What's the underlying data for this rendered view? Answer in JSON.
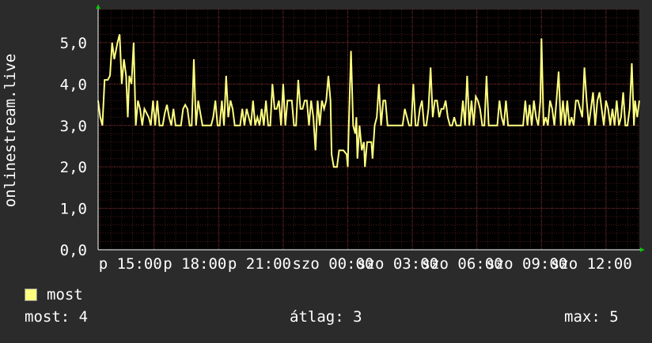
{
  "chart_data": {
    "type": "line",
    "ylabel": "onlinestream.live",
    "ylim": [
      0,
      5.8
    ],
    "yticks": [
      0,
      1,
      2,
      3,
      4,
      5
    ],
    "ytick_labels": [
      "0,0",
      "1,0",
      "2,0",
      "3,0",
      "4,0",
      "5,0"
    ],
    "xlim": [
      12.4,
      37.55
    ],
    "xticks": [
      15,
      18,
      21,
      24,
      27,
      30,
      33,
      36
    ],
    "xtick_labels": [
      "p 15:00",
      "p 18:00",
      "p 21:00",
      "szo 00:00",
      "szo 03:00",
      "szo 06:00",
      "szo 09:00",
      "szo 12:00"
    ],
    "grid": true,
    "series": [
      {
        "name": "most",
        "color": "#ffff80",
        "points": [
          [
            12.4,
            3.6
          ],
          [
            12.5,
            3.2
          ],
          [
            12.6,
            3.0
          ],
          [
            12.7,
            4.1
          ],
          [
            12.85,
            4.1
          ],
          [
            12.95,
            4.2
          ],
          [
            13.05,
            5.0
          ],
          [
            13.15,
            4.6
          ],
          [
            13.3,
            5.0
          ],
          [
            13.4,
            5.2
          ],
          [
            13.5,
            4.0
          ],
          [
            13.6,
            4.6
          ],
          [
            13.7,
            4.2
          ],
          [
            13.78,
            3.2
          ],
          [
            13.85,
            4.2
          ],
          [
            13.95,
            4.0
          ],
          [
            14.05,
            5.0
          ],
          [
            14.15,
            3.0
          ],
          [
            14.25,
            3.6
          ],
          [
            14.35,
            3.4
          ],
          [
            14.45,
            3.0
          ],
          [
            14.55,
            3.4
          ],
          [
            14.65,
            3.3
          ],
          [
            14.75,
            3.2
          ],
          [
            14.85,
            3.0
          ],
          [
            14.95,
            3.6
          ],
          [
            15.05,
            3.0
          ],
          [
            15.15,
            3.6
          ],
          [
            15.25,
            3.0
          ],
          [
            15.4,
            3.0
          ],
          [
            15.5,
            3.3
          ],
          [
            15.6,
            3.5
          ],
          [
            15.7,
            3.2
          ],
          [
            15.8,
            3.0
          ],
          [
            15.9,
            3.4
          ],
          [
            16.0,
            3.0
          ],
          [
            16.1,
            3.0
          ],
          [
            16.25,
            3.0
          ],
          [
            16.35,
            3.4
          ],
          [
            16.45,
            3.5
          ],
          [
            16.55,
            3.4
          ],
          [
            16.65,
            3.0
          ],
          [
            16.75,
            3.0
          ],
          [
            16.85,
            4.6
          ],
          [
            16.95,
            3.0
          ],
          [
            17.05,
            3.6
          ],
          [
            17.15,
            3.3
          ],
          [
            17.25,
            3.0
          ],
          [
            17.4,
            3.0
          ],
          [
            17.55,
            3.0
          ],
          [
            17.65,
            3.0
          ],
          [
            17.75,
            3.2
          ],
          [
            17.85,
            3.6
          ],
          [
            17.95,
            3.0
          ],
          [
            18.05,
            3.0
          ],
          [
            18.15,
            3.6
          ],
          [
            18.25,
            3.0
          ],
          [
            18.35,
            4.2
          ],
          [
            18.45,
            3.2
          ],
          [
            18.55,
            3.6
          ],
          [
            18.65,
            3.4
          ],
          [
            18.75,
            3.0
          ],
          [
            18.85,
            3.0
          ],
          [
            19.0,
            3.0
          ],
          [
            19.1,
            3.4
          ],
          [
            19.2,
            3.0
          ],
          [
            19.3,
            3.4
          ],
          [
            19.4,
            3.2
          ],
          [
            19.5,
            3.0
          ],
          [
            19.6,
            3.6
          ],
          [
            19.7,
            3.0
          ],
          [
            19.8,
            3.2
          ],
          [
            19.9,
            3.0
          ],
          [
            20.0,
            3.4
          ],
          [
            20.1,
            3.0
          ],
          [
            20.2,
            3.6
          ],
          [
            20.3,
            3.0
          ],
          [
            20.4,
            3.0
          ],
          [
            20.5,
            4.0
          ],
          [
            20.6,
            3.4
          ],
          [
            20.7,
            3.4
          ],
          [
            20.8,
            3.6
          ],
          [
            20.9,
            3.0
          ],
          [
            21.0,
            4.0
          ],
          [
            21.1,
            3.0
          ],
          [
            21.2,
            3.6
          ],
          [
            21.3,
            3.6
          ],
          [
            21.4,
            3.6
          ],
          [
            21.5,
            3.0
          ],
          [
            21.6,
            3.0
          ],
          [
            21.7,
            4.1
          ],
          [
            21.8,
            3.4
          ],
          [
            21.9,
            3.4
          ],
          [
            22.0,
            3.6
          ],
          [
            22.1,
            3.6
          ],
          [
            22.2,
            3.0
          ],
          [
            22.3,
            3.6
          ],
          [
            22.4,
            3.2
          ],
          [
            22.5,
            2.4
          ],
          [
            22.6,
            3.6
          ],
          [
            22.7,
            3.0
          ],
          [
            22.8,
            3.6
          ],
          [
            22.9,
            3.4
          ],
          [
            23.0,
            3.6
          ],
          [
            23.1,
            4.2
          ],
          [
            23.2,
            3.6
          ],
          [
            23.25,
            2.3
          ],
          [
            23.35,
            2.0
          ],
          [
            23.5,
            2.0
          ],
          [
            23.6,
            2.4
          ],
          [
            23.8,
            2.4
          ],
          [
            23.95,
            2.3
          ],
          [
            24.0,
            2.0
          ],
          [
            24.05,
            3.0
          ],
          [
            24.15,
            4.8
          ],
          [
            24.25,
            3.0
          ],
          [
            24.35,
            2.8
          ],
          [
            24.4,
            3.2
          ],
          [
            24.45,
            2.2
          ],
          [
            24.55,
            3.0
          ],
          [
            24.65,
            2.4
          ],
          [
            24.75,
            2.6
          ],
          [
            24.8,
            2.0
          ],
          [
            24.9,
            2.6
          ],
          [
            25.0,
            2.6
          ],
          [
            25.1,
            2.6
          ],
          [
            25.15,
            2.2
          ],
          [
            25.25,
            3.0
          ],
          [
            25.35,
            3.2
          ],
          [
            25.45,
            4.0
          ],
          [
            25.55,
            3.0
          ],
          [
            25.65,
            3.6
          ],
          [
            25.75,
            3.6
          ],
          [
            25.85,
            3.0
          ],
          [
            25.95,
            3.0
          ],
          [
            26.1,
            3.0
          ],
          [
            26.2,
            3.0
          ],
          [
            26.35,
            3.0
          ],
          [
            26.45,
            3.0
          ],
          [
            26.55,
            3.0
          ],
          [
            26.65,
            3.4
          ],
          [
            26.75,
            3.2
          ],
          [
            26.85,
            3.0
          ],
          [
            26.95,
            3.0
          ],
          [
            27.05,
            4.0
          ],
          [
            27.15,
            3.0
          ],
          [
            27.25,
            3.0
          ],
          [
            27.35,
            3.4
          ],
          [
            27.45,
            3.6
          ],
          [
            27.55,
            3.0
          ],
          [
            27.65,
            3.0
          ],
          [
            27.75,
            3.4
          ],
          [
            27.85,
            4.4
          ],
          [
            27.95,
            3.2
          ],
          [
            28.05,
            3.6
          ],
          [
            28.15,
            3.6
          ],
          [
            28.25,
            3.2
          ],
          [
            28.35,
            3.4
          ],
          [
            28.45,
            3.4
          ],
          [
            28.55,
            3.6
          ],
          [
            28.65,
            3.2
          ],
          [
            28.75,
            3.0
          ],
          [
            28.85,
            3.0
          ],
          [
            28.95,
            3.2
          ],
          [
            29.05,
            3.0
          ],
          [
            29.15,
            3.0
          ],
          [
            29.25,
            3.0
          ],
          [
            29.35,
            3.6
          ],
          [
            29.45,
            3.0
          ],
          [
            29.55,
            4.2
          ],
          [
            29.65,
            3.0
          ],
          [
            29.75,
            3.6
          ],
          [
            29.85,
            3.0
          ],
          [
            29.95,
            3.7
          ],
          [
            30.05,
            3.6
          ],
          [
            30.15,
            3.4
          ],
          [
            30.25,
            3.0
          ],
          [
            30.35,
            3.0
          ],
          [
            30.45,
            4.2
          ],
          [
            30.55,
            3.0
          ],
          [
            30.65,
            3.0
          ],
          [
            30.75,
            3.0
          ],
          [
            30.85,
            3.0
          ],
          [
            30.95,
            3.0
          ],
          [
            31.05,
            3.6
          ],
          [
            31.15,
            3.2
          ],
          [
            31.25,
            3.0
          ],
          [
            31.35,
            3.6
          ],
          [
            31.45,
            3.0
          ],
          [
            31.55,
            3.0
          ],
          [
            31.65,
            3.0
          ],
          [
            31.75,
            3.0
          ],
          [
            31.85,
            3.0
          ],
          [
            31.95,
            3.0
          ],
          [
            32.05,
            3.0
          ],
          [
            32.15,
            3.0
          ],
          [
            32.25,
            3.6
          ],
          [
            32.35,
            3.0
          ],
          [
            32.45,
            3.5
          ],
          [
            32.55,
            3.0
          ],
          [
            32.65,
            3.6
          ],
          [
            32.75,
            3.2
          ],
          [
            32.85,
            3.0
          ],
          [
            32.95,
            3.6
          ],
          [
            33.0,
            5.1
          ],
          [
            33.1,
            3.0
          ],
          [
            33.2,
            3.2
          ],
          [
            33.3,
            3.0
          ],
          [
            33.4,
            3.6
          ],
          [
            33.5,
            3.4
          ],
          [
            33.6,
            3.0
          ],
          [
            33.7,
            3.6
          ],
          [
            33.8,
            4.3
          ],
          [
            33.9,
            3.0
          ],
          [
            34.0,
            3.6
          ],
          [
            34.1,
            3.0
          ],
          [
            34.2,
            3.6
          ],
          [
            34.3,
            3.0
          ],
          [
            34.4,
            3.2
          ],
          [
            34.5,
            3.0
          ],
          [
            34.6,
            3.6
          ],
          [
            34.7,
            3.6
          ],
          [
            34.8,
            3.4
          ],
          [
            34.9,
            3.2
          ],
          [
            35.0,
            4.4
          ],
          [
            35.1,
            3.6
          ],
          [
            35.2,
            3.0
          ],
          [
            35.3,
            3.4
          ],
          [
            35.4,
            3.8
          ],
          [
            35.5,
            3.0
          ],
          [
            35.6,
            3.6
          ],
          [
            35.7,
            3.8
          ],
          [
            35.8,
            3.4
          ],
          [
            35.9,
            3.0
          ],
          [
            36.0,
            3.6
          ],
          [
            36.1,
            3.4
          ],
          [
            36.2,
            3.0
          ],
          [
            36.3,
            3.4
          ],
          [
            36.4,
            3.0
          ],
          [
            36.5,
            3.6
          ],
          [
            36.6,
            3.0
          ],
          [
            36.7,
            3.2
          ],
          [
            36.8,
            3.8
          ],
          [
            36.9,
            3.0
          ],
          [
            37.0,
            3.0
          ],
          [
            37.1,
            3.4
          ],
          [
            37.2,
            4.5
          ],
          [
            37.3,
            3.0
          ],
          [
            37.35,
            3.6
          ],
          [
            37.45,
            3.2
          ],
          [
            37.55,
            3.6
          ]
        ]
      }
    ]
  },
  "legend": {
    "label": "most"
  },
  "stats": {
    "current": "most: 4",
    "average": "átlag: 3",
    "maximum": "max: 5"
  }
}
